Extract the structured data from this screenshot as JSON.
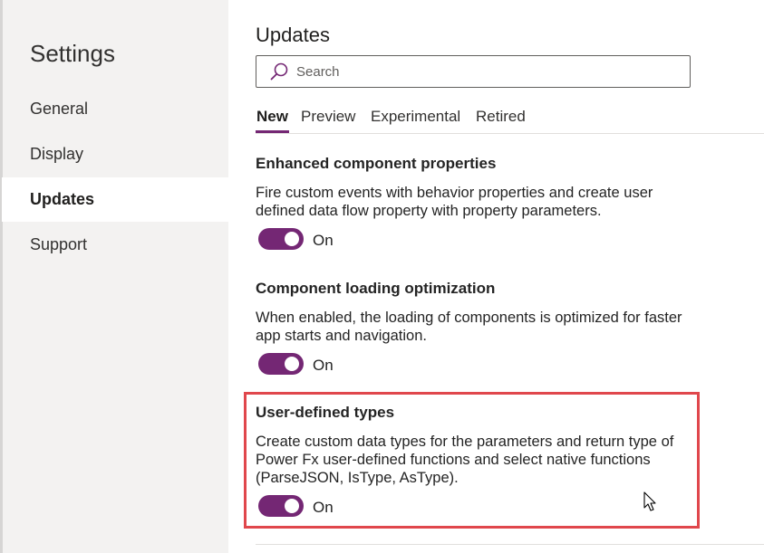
{
  "sidebar": {
    "title": "Settings",
    "items": [
      {
        "label": "General"
      },
      {
        "label": "Display"
      },
      {
        "label": "Updates"
      },
      {
        "label": "Support"
      }
    ]
  },
  "main": {
    "title": "Updates",
    "search": {
      "placeholder": "Search",
      "value": ""
    },
    "tabs": [
      {
        "label": "New"
      },
      {
        "label": "Preview"
      },
      {
        "label": "Experimental"
      },
      {
        "label": "Retired"
      }
    ],
    "settings": [
      {
        "title": "Enhanced component properties",
        "description": "Fire custom events with behavior properties and create user defined data flow property with property parameters.",
        "toggle_label": "On"
      },
      {
        "title": "Component loading optimization",
        "description": "When enabled, the loading of components is optimized for faster app starts and navigation.",
        "toggle_label": "On"
      },
      {
        "title": "User-defined types",
        "description": "Create custom data types for the parameters and return type of Power Fx user-defined functions and select native functions (ParseJSON, IsType, AsType).",
        "toggle_label": "On"
      }
    ]
  },
  "colors": {
    "accent": "#742774",
    "highlight": "#e0474c",
    "sidebar_bg": "#f3f2f1"
  },
  "icons": {
    "search": "search-icon",
    "cursor": "mouse-cursor-icon"
  }
}
